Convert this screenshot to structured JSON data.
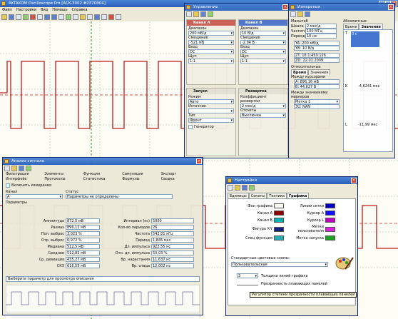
{
  "main": {
    "title": "AKTAKOM Oscilloscope Pro [ACK-3002 #2370004]",
    "menu": [
      "Файл",
      "Настройки",
      "Вид",
      "Помощь",
      "Справка"
    ]
  },
  "ctrl": {
    "title": "Управление",
    "chA": {
      "label": "Канал А",
      "range_label": "Диапазон",
      "range": "200 мВ/д",
      "offset_label": "Смещение",
      "offset": "-521 мВ",
      "input_label": "Вход",
      "input": "DC",
      "probe_label": "Щуп",
      "probe": "1:1"
    },
    "chB": {
      "label": "Канал B",
      "range_label": "Диапазон",
      "range": "10 В/д",
      "offset_label": "Смещение",
      "offset": "-2.94 В",
      "input_label": "Вход",
      "input": "DC",
      "probe_label": "Щуп",
      "probe": "1:1"
    },
    "trig": {
      "label": "Запуск",
      "mode_label": "Режим",
      "mode": "Авто",
      "src_label": "Источник",
      "type_label": "Тип",
      "type": "Фронт",
      "gen": "Генератор"
    },
    "sweep": {
      "label": "Развертка",
      "coeff_label": "Коэффициент развертки",
      "coeff": "2 мкс/д",
      "sampling_label": "Отсчеты",
      "sampling": "Выключен"
    }
  },
  "meas": {
    "title": "Измерения",
    "scale_title": "Масштаб",
    "scale_label": "Шкала",
    "scale": "2 мкс/д",
    "freq_label": "Частота",
    "freq": "100 МГц",
    "period_label": "Период",
    "period": "10 нс",
    "ya": "YA: 200 мВ/д",
    "yb": "YB: 10 В/д",
    "zt": "ZT: 16:1:459:126",
    "zd": "ZD: 22.01.2009",
    "rel_title": "Относительные",
    "rel_tabs": [
      "Время",
      "Значения"
    ],
    "cursors_label": "Между курсорами",
    "cursor_a": "A: 896,16 мВ",
    "cursor_b": "B: 44,627 В",
    "markers_label": "Между значениями маркеров",
    "marker": "Метка 1",
    "marker_val": "ЗU: NAN",
    "abs_title": "Абсолютные",
    "abs_tabs": [
      "Время",
      "Значения"
    ],
    "t_label": "T",
    "t_val": "0 с",
    "k_label": "K",
    "k_val": "-4,6241 мкс",
    "l_label": "L",
    "l_val": "-11,99 мкс"
  },
  "analysis": {
    "title": "Анализ сигнала",
    "menu": [
      "Фильтрация",
      "Элементы",
      "Функция",
      "Симуляция",
      "Экспорт",
      "Интерфейс",
      "Протоколы",
      "Статистика",
      "Формулы",
      "Сводка"
    ],
    "include_label": "Включить измерения",
    "channel_label": "Канал",
    "channel": "A",
    "status_label": "Статус",
    "status": "Параметры не определены",
    "params_label": "Параметры",
    "params_left": [
      [
        "Амплитуда",
        "872,5 мВ"
      ],
      [
        "Размах",
        "896,12 мВ"
      ],
      [
        "Пол. выброс",
        "3,023 %"
      ],
      [
        "Отр. выброс",
        "0,972 %"
      ],
      [
        "Медиана",
        "512,5 мВ"
      ],
      [
        "Среднее",
        "512,82 мВ"
      ],
      [
        "Ср. девиация",
        "435,27 мВ"
      ],
      [
        "СКЗ",
        "616,55 мВ"
      ]
    ],
    "params_right": [
      [
        "Интервал (кс)",
        "5000"
      ],
      [
        "Кол-во периодов",
        "26"
      ],
      [
        "Частота",
        "542,01 кГц"
      ],
      [
        "Период",
        "1,845 мкс"
      ],
      [
        "Дл. импульса",
        "922,55 нс"
      ],
      [
        "Отн. дл. импульса",
        "50,03 %"
      ],
      [
        "Вр. нарастания",
        "11,637 нс"
      ],
      [
        "Вр. спада",
        "12,002 нс"
      ]
    ],
    "hint": "Выберите параметр для просмотра описания"
  },
  "settings": {
    "title": "Настройки",
    "tabs": [
      "Единицы",
      "Сокеты",
      "Техника",
      "Графика"
    ],
    "bg_label": "Фон графика",
    "grid_label": "Линии сетки",
    "chA_label": "Канал А",
    "curA_label": "Курсор A",
    "chB_label": "Канал B",
    "curB_label": "Курсор L",
    "xy_label": "Фигура X-Y",
    "user_label": "Метки пользователя",
    "spec_label": "Спец функция",
    "trig_label": "Метка запуска",
    "scheme_label": "Стандартные цветовые схемы:",
    "scheme": "Пользовательская",
    "thick": "3",
    "thick_label": "Толщина линий графика",
    "transp_label": "Прозрачность плавающих панелей",
    "tooltip": "Регулятор степени прозрачности плавающих панелей"
  },
  "colors": {
    "bg": "#fdfcf5",
    "grid": "#0000c8",
    "chA": "#8b0000",
    "curA": "#1010ff",
    "chB": "#00b0b0",
    "curB": "#c000c0",
    "xy": "#102080",
    "user": "#e020e0",
    "spec": "#2ea9b8",
    "trig": "#20a020",
    "traceA": "#c01818",
    "traceB": "#6aa86a"
  },
  "icons": [
    "app-icon",
    "minimize-icon",
    "maximize-icon",
    "close-icon",
    "palette-icon",
    "dropper-icon"
  ]
}
